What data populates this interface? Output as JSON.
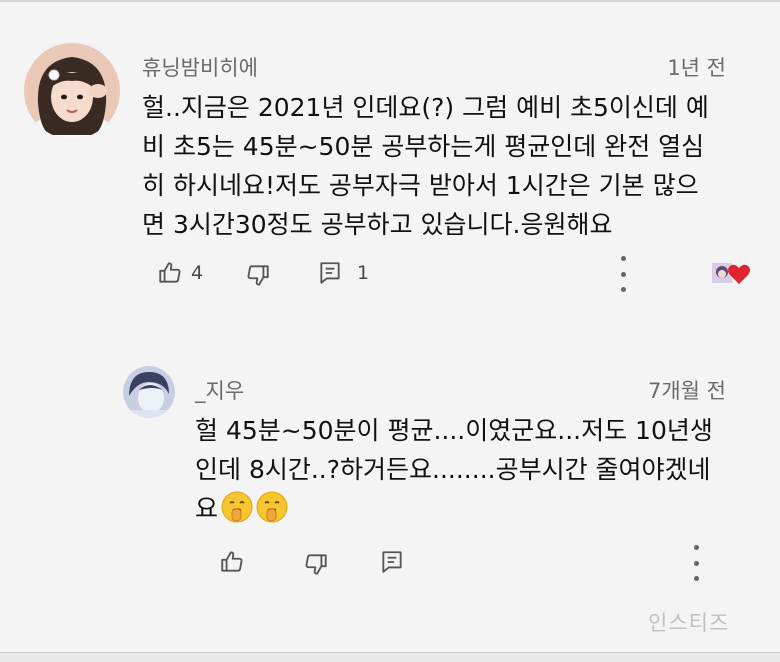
{
  "comment": {
    "author": "휴닝밤비히에",
    "time": "1년 전",
    "lines": [
      "헐..지금은 2021년 인데요(?) 그럼 예비 초5이신데 예",
      "비 초5는 45분~50분 공부하는게 평균인데 완전 열심",
      "히 하시네요!저도 공부자극 받아서 1시간은 기본 많으",
      "면 3시간30정도 공부하고 있습니다.응원해요"
    ],
    "like_count": "4",
    "reply_count": "1"
  },
  "reply": {
    "author": "_지우",
    "time": "7개월 전",
    "lines": [
      "헐 45분~50분이 평균....이였군요...저도 10년생",
      "인데 8시간..?하거든요........공부시간 줄여야겠네",
      "요"
    ],
    "emoji": [
      "shushing-face",
      "shushing-face"
    ]
  },
  "watermark": "인스티즈",
  "colors": {
    "background": "#f4f4f4",
    "meta_text": "#6a6a6a",
    "heart": "#e0242f"
  },
  "icons": [
    "thumbs-up-icon",
    "thumbs-down-icon",
    "reply-icon",
    "more-vert-icon",
    "creator-heart-icon"
  ]
}
